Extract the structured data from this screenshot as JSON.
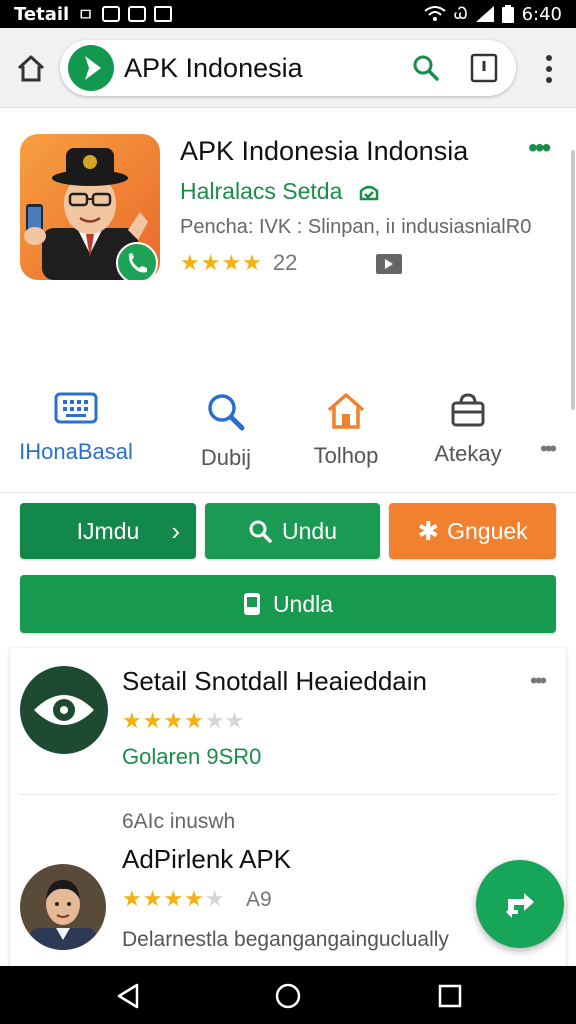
{
  "status_bar": {
    "carrier": "Tetail",
    "carrier_suffix": "ㅁ",
    "signal_label": "Ꮗ",
    "time": "6:40"
  },
  "toolbar": {
    "url_text": "APK Indonesia"
  },
  "app": {
    "title": "APK Indonesia Indonsia",
    "developer": "Halralacs Setda",
    "meta": "Pencha: IVK : Slinpan, iı indusiasnialR0",
    "rating_count": "22",
    "stars_filled": 4,
    "stars_total": 4
  },
  "nav": [
    {
      "label": "IHonaBasal",
      "icon": "keyboard-icon",
      "active": true
    },
    {
      "label": "Dubij",
      "icon": "search-icon",
      "active": false
    },
    {
      "label": "Tolhop",
      "icon": "home-icon",
      "active": false
    },
    {
      "label": "Atekay",
      "icon": "bag-icon",
      "active": false
    }
  ],
  "buttons": {
    "b1_label": "IJmdu",
    "b1_chevron": "›",
    "b2_label": "Undu",
    "b3_label": "Gnguek",
    "b4_label": "Undla"
  },
  "list": {
    "item1": {
      "title": "Setail Snotdall Heaieddain",
      "stars_filled": 4,
      "stars_total": 6,
      "subtitle": "Golaren 9SR0"
    },
    "section_label": "6AIc inuswh",
    "item2": {
      "title": "AdPirlenk APK",
      "stars_filled": 4,
      "stars_total": 5,
      "rating": "A9",
      "subtitle": "Delarnestla begangangainguclually"
    }
  },
  "colors": {
    "green": "#1a8d4a",
    "orange": "#f1812e",
    "blue": "#2a6fd0",
    "star": "#f5b014"
  }
}
